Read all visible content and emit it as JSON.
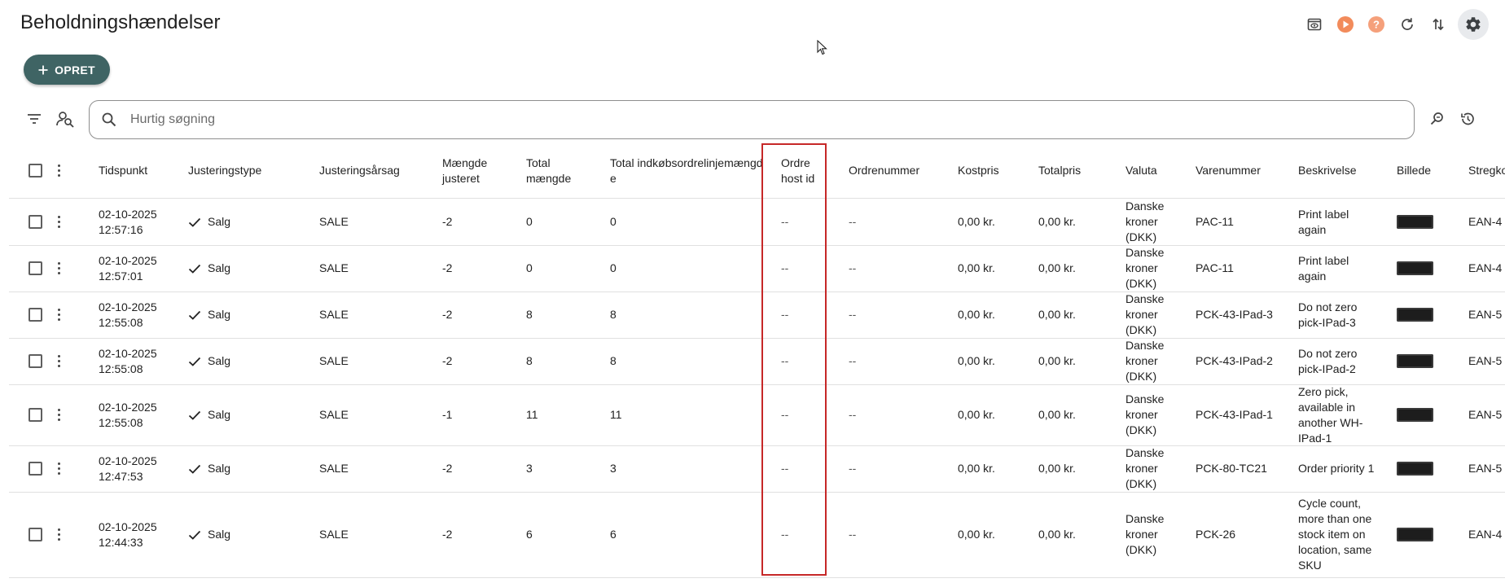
{
  "page": {
    "title": "Beholdningshændelser"
  },
  "toolbar": {
    "icons": [
      "preview-icon",
      "play-icon",
      "help-icon",
      "refresh-icon",
      "sort-arrows-icon",
      "gear-icon"
    ],
    "accent_color": "#f28b5b"
  },
  "create_button": {
    "label": "OPRET",
    "color": "#3f6464"
  },
  "search": {
    "placeholder": "Hurtig søgning",
    "value": ""
  },
  "table": {
    "columns": [
      {
        "key": "tidspunkt",
        "label": "Tidspunkt"
      },
      {
        "key": "justeringstype",
        "label": "Justeringstype"
      },
      {
        "key": "justeringsaarsag",
        "label": "Justeringsårsag"
      },
      {
        "key": "maengde_justeret",
        "label": "Mængde justeret"
      },
      {
        "key": "total_maengde",
        "label": "Total mængde"
      },
      {
        "key": "total_indkob",
        "label": "Total indkøbsordrelinjemængde"
      },
      {
        "key": "ordre_host_id",
        "label": "Ordre host id"
      },
      {
        "key": "ordrenummer",
        "label": "Ordrenummer"
      },
      {
        "key": "kostpris",
        "label": "Kostpris"
      },
      {
        "key": "totalpris",
        "label": "Totalpris"
      },
      {
        "key": "valuta",
        "label": "Valuta"
      },
      {
        "key": "varenummer",
        "label": "Varenummer"
      },
      {
        "key": "beskrivelse",
        "label": "Beskrivelse"
      },
      {
        "key": "billede",
        "label": "Billede"
      },
      {
        "key": "stregkode",
        "label": "Stregko"
      }
    ],
    "rows": [
      {
        "tidspunkt": "02-10-2025 12:57:16",
        "justeringstype": "Salg",
        "justeringsaarsag": "SALE",
        "maengde_justeret": "-2",
        "total_maengde": "0",
        "total_indkob": "0",
        "ordre_host_id": "--",
        "ordrenummer": "--",
        "kostpris": "0,00 kr.",
        "totalpris": "0,00 kr.",
        "valuta": "Danske kroner (DKK)",
        "varenummer": "PAC-11",
        "beskrivelse": "Print label again",
        "stregkode": "EAN-4"
      },
      {
        "tidspunkt": "02-10-2025 12:57:01",
        "justeringstype": "Salg",
        "justeringsaarsag": "SALE",
        "maengde_justeret": "-2",
        "total_maengde": "0",
        "total_indkob": "0",
        "ordre_host_id": "--",
        "ordrenummer": "--",
        "kostpris": "0,00 kr.",
        "totalpris": "0,00 kr.",
        "valuta": "Danske kroner (DKK)",
        "varenummer": "PAC-11",
        "beskrivelse": "Print label again",
        "stregkode": "EAN-4"
      },
      {
        "tidspunkt": "02-10-2025 12:55:08",
        "justeringstype": "Salg",
        "justeringsaarsag": "SALE",
        "maengde_justeret": "-2",
        "total_maengde": "8",
        "total_indkob": "8",
        "ordre_host_id": "--",
        "ordrenummer": "--",
        "kostpris": "0,00 kr.",
        "totalpris": "0,00 kr.",
        "valuta": "Danske kroner (DKK)",
        "varenummer": "PCK-43-IPad-3",
        "beskrivelse": "Do not zero pick-IPad-3",
        "stregkode": "EAN-5"
      },
      {
        "tidspunkt": "02-10-2025 12:55:08",
        "justeringstype": "Salg",
        "justeringsaarsag": "SALE",
        "maengde_justeret": "-2",
        "total_maengde": "8",
        "total_indkob": "8",
        "ordre_host_id": "--",
        "ordrenummer": "--",
        "kostpris": "0,00 kr.",
        "totalpris": "0,00 kr.",
        "valuta": "Danske kroner (DKK)",
        "varenummer": "PCK-43-IPad-2",
        "beskrivelse": "Do not zero pick-IPad-2",
        "stregkode": "EAN-5"
      },
      {
        "tidspunkt": "02-10-2025 12:55:08",
        "justeringstype": "Salg",
        "justeringsaarsag": "SALE",
        "maengde_justeret": "-1",
        "total_maengde": "11",
        "total_indkob": "11",
        "ordre_host_id": "--",
        "ordrenummer": "--",
        "kostpris": "0,00 kr.",
        "totalpris": "0,00 kr.",
        "valuta": "Danske kroner (DKK)",
        "varenummer": "PCK-43-IPad-1",
        "beskrivelse": "Zero pick, available in another WH-IPad-1",
        "stregkode": "EAN-5"
      },
      {
        "tidspunkt": "02-10-2025 12:47:53",
        "justeringstype": "Salg",
        "justeringsaarsag": "SALE",
        "maengde_justeret": "-2",
        "total_maengde": "3",
        "total_indkob": "3",
        "ordre_host_id": "--",
        "ordrenummer": "--",
        "kostpris": "0,00 kr.",
        "totalpris": "0,00 kr.",
        "valuta": "Danske kroner (DKK)",
        "varenummer": "PCK-80-TC21",
        "beskrivelse": "Order priority 1",
        "stregkode": "EAN-5"
      },
      {
        "tidspunkt": "02-10-2025 12:44:33",
        "justeringstype": "Salg",
        "justeringsaarsag": "SALE",
        "maengde_justeret": "-2",
        "total_maengde": "6",
        "total_indkob": "6",
        "ordre_host_id": "--",
        "ordrenummer": "--",
        "kostpris": "0,00 kr.",
        "totalpris": "0,00 kr.",
        "valuta": "Danske kroner (DKK)",
        "varenummer": "PCK-26",
        "beskrivelse": "Cycle count, more than one stock item on location, same SKU",
        "stregkode": "EAN-4"
      }
    ]
  },
  "highlight": {
    "column": "Ordre host id",
    "color": "#c62828"
  }
}
